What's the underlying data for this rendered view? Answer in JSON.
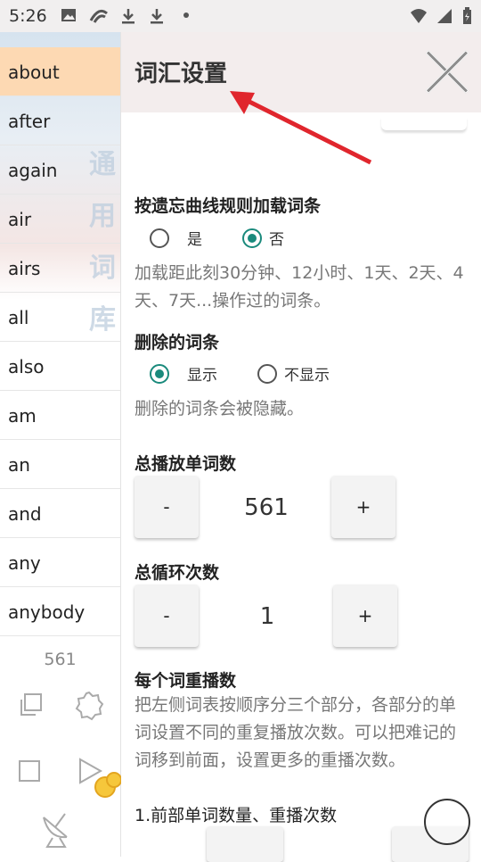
{
  "status_bar": {
    "time": "5:26"
  },
  "sidebar": {
    "background_text": [
      "通",
      "用",
      "词",
      "库"
    ],
    "words": [
      "about",
      "after",
      "again",
      "air",
      "airs",
      "all",
      "also",
      "am",
      "an",
      "and",
      "any",
      "anybody"
    ],
    "active_index": 0,
    "word_count": "561"
  },
  "panel": {
    "title": "词汇设置",
    "forgetting_curve": {
      "title": "按遗忘曲线规则加载词条",
      "options": [
        "是",
        "否"
      ],
      "selected": "否",
      "description": "加载距此刻30分钟、12小时、1天、2天、4天、7天...操作过的词条。"
    },
    "deleted_entries": {
      "title": "删除的词条",
      "options": [
        "显示",
        "不显示"
      ],
      "selected": "显示",
      "description": "删除的词条会被隐藏。"
    },
    "total_words": {
      "title": "总播放单词数",
      "minus": "-",
      "plus": "+",
      "value": "561"
    },
    "total_loops": {
      "title": "总循环次数",
      "minus": "-",
      "plus": "+",
      "value": "1"
    },
    "per_word_repeat": {
      "title": "每个词重播数",
      "description": "把左侧词表按顺序分三个部分，各部分的单词设置不同的重复播放次数。可以把难记的词移到前面，设置更多的重播次数。",
      "front_part_label": "1.前部单词数量、重播次数"
    }
  },
  "colors": {
    "accent": "#1a8a7c",
    "active_word_bg": "#fdd9b3",
    "header_bg": "#f3eded",
    "arrow": "#e0262d"
  }
}
